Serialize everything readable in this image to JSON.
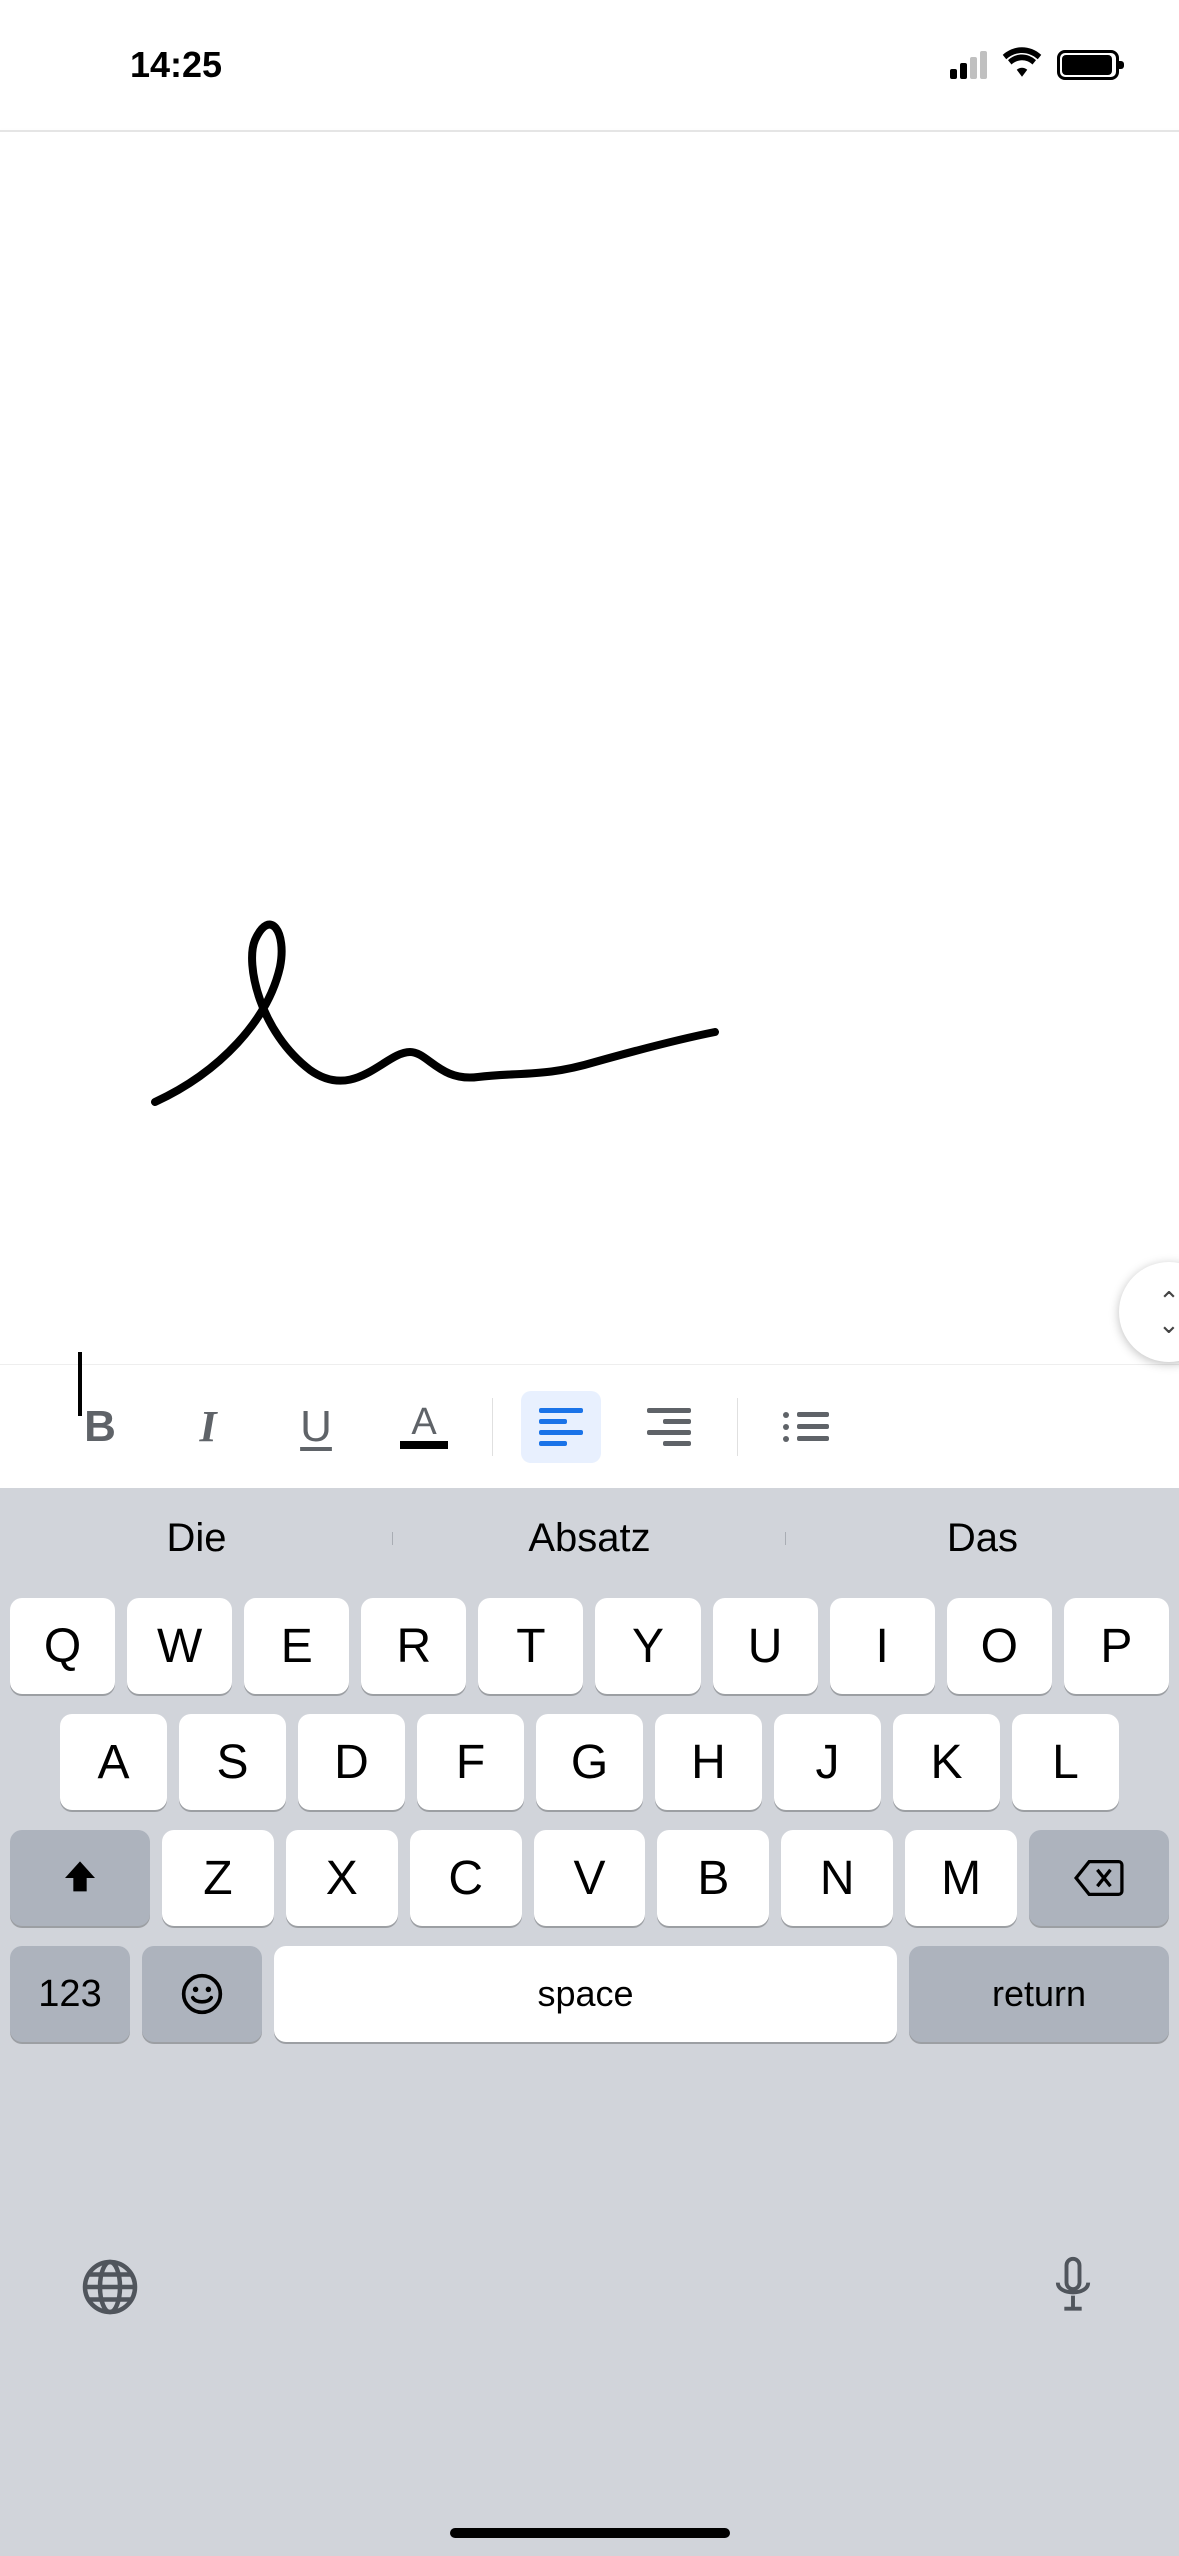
{
  "status": {
    "time": "14:25"
  },
  "toolbar": {
    "bold": "B",
    "italic": "I",
    "underline": "U",
    "textcolor_letter": "A"
  },
  "suggestions": [
    "Die",
    "Absatz",
    "Das"
  ],
  "keys": {
    "row1": [
      "Q",
      "W",
      "E",
      "R",
      "T",
      "Y",
      "U",
      "I",
      "O",
      "P"
    ],
    "row2": [
      "A",
      "S",
      "D",
      "F",
      "G",
      "H",
      "J",
      "K",
      "L"
    ],
    "row3": [
      "Z",
      "X",
      "C",
      "V",
      "B",
      "N",
      "M"
    ],
    "numbers": "123",
    "space": "space",
    "return": "return"
  }
}
